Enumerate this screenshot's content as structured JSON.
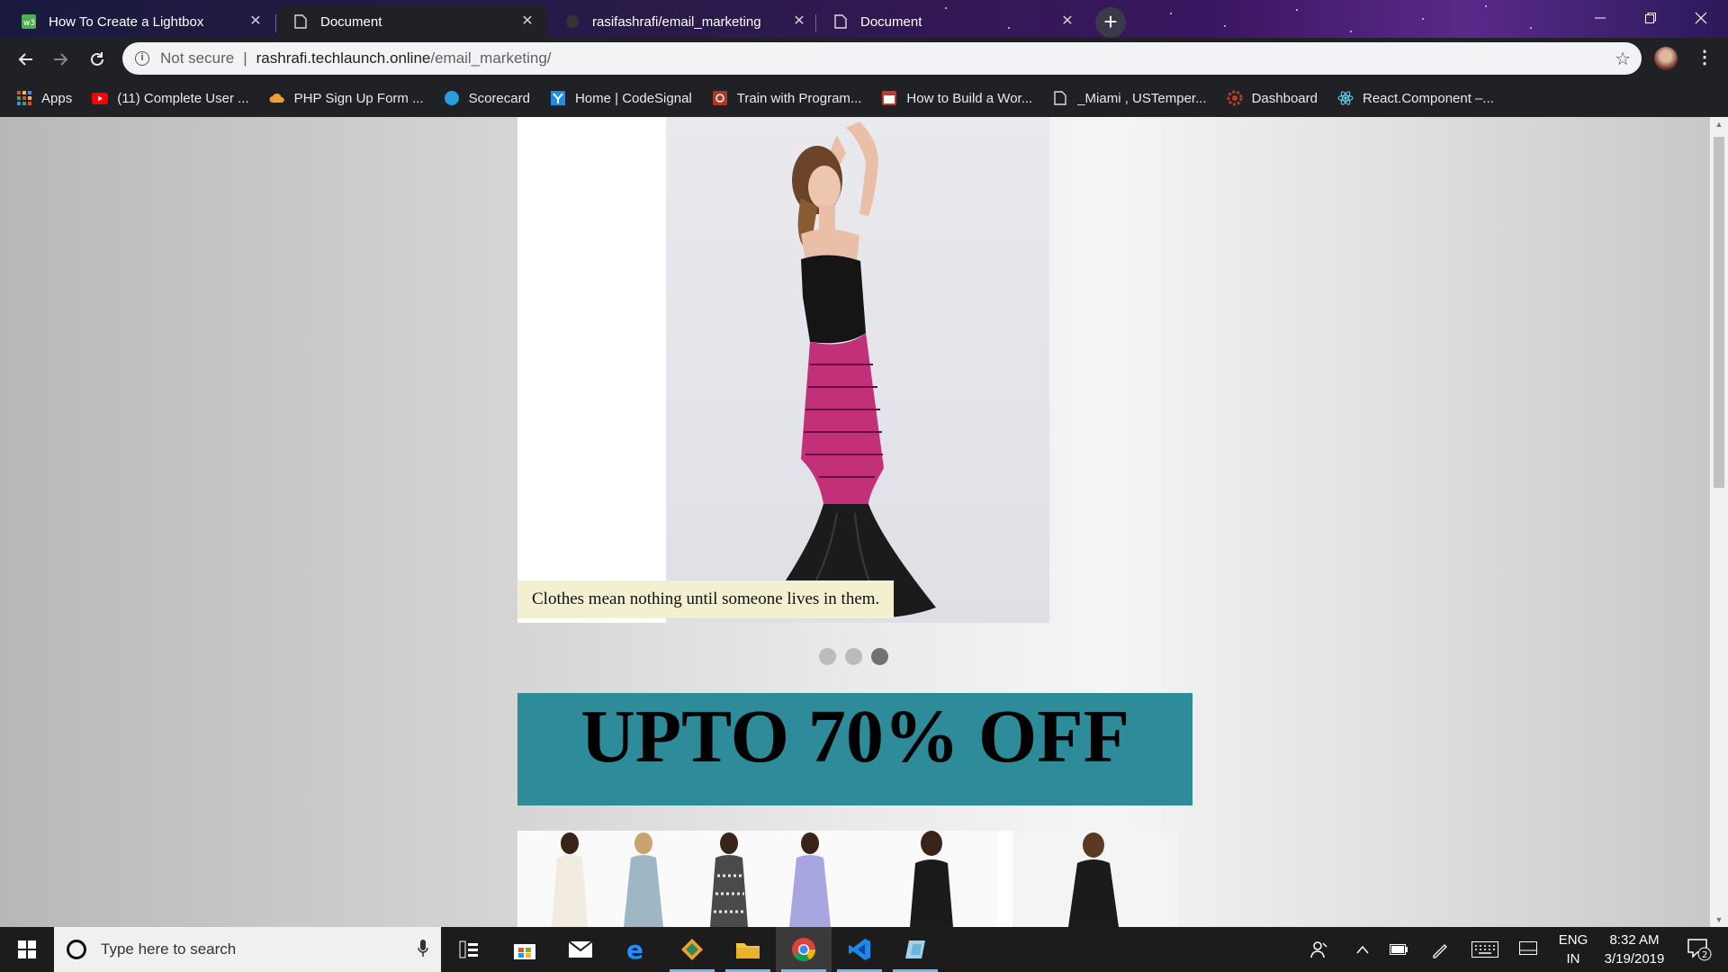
{
  "browser": {
    "tabs": [
      {
        "title": "How To Create a Lightbox",
        "favicon": "w3schools-icon",
        "active": false
      },
      {
        "title": "Document",
        "favicon": "document-icon",
        "active": true
      },
      {
        "title": "rasifashrafi/email_marketing",
        "favicon": "github-icon",
        "active": false
      },
      {
        "title": "Document",
        "favicon": "document-icon",
        "active": false
      }
    ],
    "new_tab_label": "+",
    "close_glyph": "✕",
    "address": {
      "security_label": "Not secure",
      "divider": "|",
      "host": "rashrafi.techlaunch.online",
      "path": "/email_marketing/"
    },
    "bookmarks": [
      {
        "label": "Apps",
        "icon": "apps-grid-icon",
        "color": "#e8453c"
      },
      {
        "label": "(11) Complete User ...",
        "icon": "youtube-icon",
        "color": "#ff0000"
      },
      {
        "label": "PHP Sign Up Form ...",
        "icon": "cloud-icon",
        "color": "#f0a030"
      },
      {
        "label": "Scorecard",
        "icon": "scorecard-icon",
        "color": "#2b9be0"
      },
      {
        "label": "Home | CodeSignal",
        "icon": "codesignal-icon",
        "color": "#1f8ce6"
      },
      {
        "label": "Train with Program...",
        "icon": "codewars-icon",
        "color": "#b1361e"
      },
      {
        "label": "How to Build a Wor...",
        "icon": "calendar-icon",
        "color": "#c0392b"
      },
      {
        "label": "_Miami , USTemper...",
        "icon": "document-icon",
        "color": "#dddddd"
      },
      {
        "label": "Dashboard",
        "icon": "gear-icon",
        "color": "#c0392b"
      },
      {
        "label": "React.Component –...",
        "icon": "react-icon",
        "color": "#61dafb"
      }
    ]
  },
  "page": {
    "slide_caption": "Clothes mean nothing until someone lives in them.",
    "slide_count": 3,
    "active_slide": 3,
    "banner_text": "UPTO 70% OFF",
    "banner_color": "#2e8b99"
  },
  "taskbar": {
    "search_placeholder": "Type here to search",
    "language_line1": "ENG",
    "language_line2": "IN",
    "time": "8:32 AM",
    "date": "3/19/2019",
    "notification_count": "2"
  }
}
